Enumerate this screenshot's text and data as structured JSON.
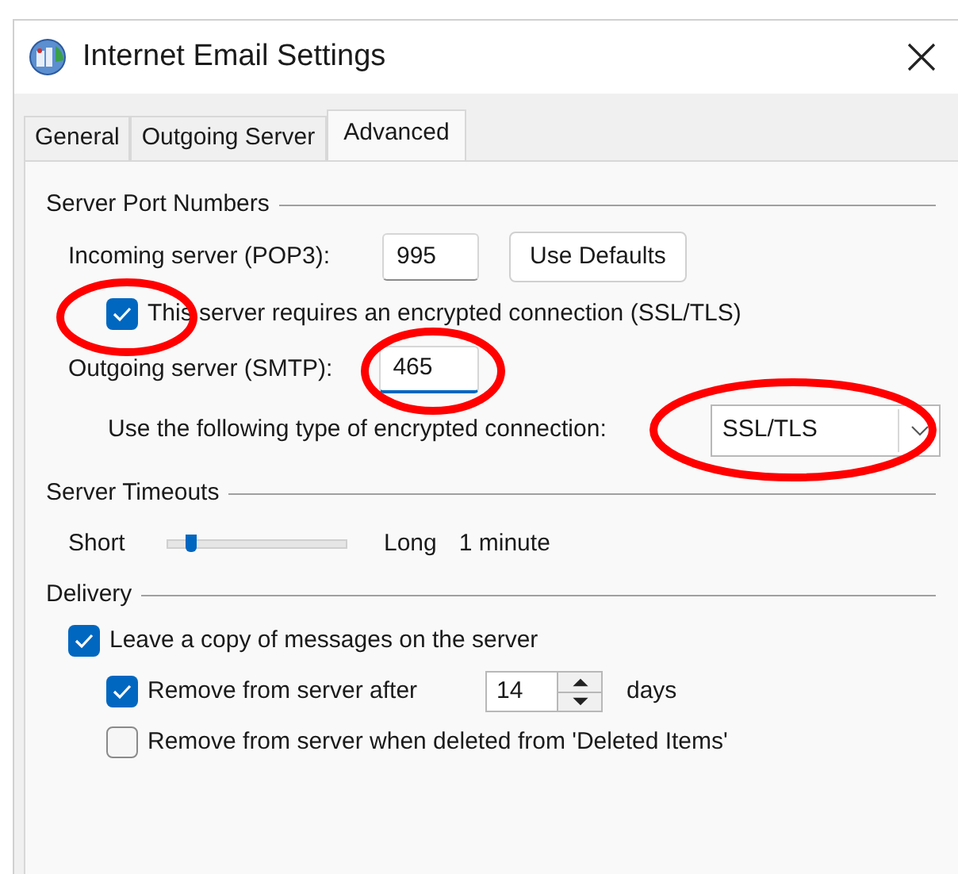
{
  "window": {
    "title": "Internet Email Settings"
  },
  "tabs": [
    {
      "label": "General",
      "selected": false
    },
    {
      "label": "Outgoing Server",
      "selected": false
    },
    {
      "label": "Advanced",
      "selected": true
    }
  ],
  "server_port_numbers": {
    "heading": "Server Port Numbers",
    "incoming": {
      "label": "Incoming server (POP3):",
      "value": "995"
    },
    "use_defaults": "Use Defaults",
    "requires_encrypted": {
      "label": "This server requires an encrypted connection (SSL/TLS)",
      "checked": true
    },
    "outgoing": {
      "label": "Outgoing server (SMTP):",
      "value": "465",
      "focused": true
    },
    "encryption": {
      "label": "Use the following type of encrypted connection:",
      "value": "SSL/TLS"
    }
  },
  "server_timeouts": {
    "heading": "Server Timeouts",
    "min_label": "Short",
    "max_label": "Long",
    "level": 0.1,
    "reading": "1 minute"
  },
  "delivery": {
    "heading": "Delivery",
    "leave_copy": {
      "label": "Leave a copy of messages on the server",
      "checked": true
    },
    "remove_after": {
      "label": "Remove from server after",
      "checked": true,
      "value": "14",
      "unit": "days"
    },
    "remove_deleted": {
      "label": "Remove from server when deleted from 'Deleted Items'",
      "checked": false
    }
  }
}
